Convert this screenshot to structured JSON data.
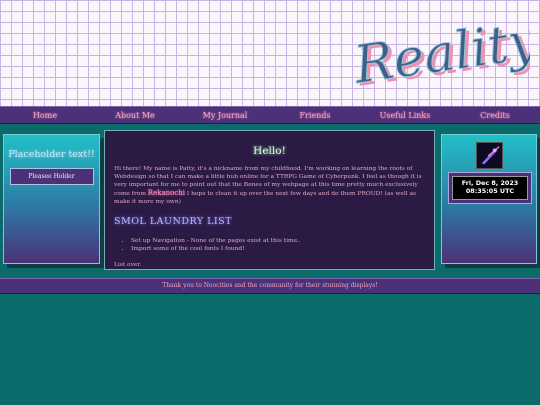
{
  "header": {
    "logo_text": "Reality"
  },
  "nav": {
    "items": [
      "Home",
      "About Me",
      "My Journal",
      "Friends",
      "Useful Links",
      "Credits"
    ]
  },
  "left_panel": {
    "title": "Placeholder text!!",
    "button": "Pleasee Holder"
  },
  "main": {
    "heading": "Hello!",
    "intro_part1": "Hi there! My name is Patty, it's a nickname from my childhood. I'm working on learning the roots of Webdesign so that I can make a little hub online for a TTRPG Game of Cyberpunk. I feel as though it is very important for me to point out that the Bones of my webpage at this time pretty much exclusively come from ",
    "intro_link": "Rekanochi",
    "intro_part2": " I hope to clean it up over the next few days and do them PROUD! (as well as make it more my own)",
    "list_heading": "SMOL LAUNDRY LIST",
    "list_items": [
      "Set up Navigation - None of the pages exist at this time..",
      "Import some of the cool fonts I found!"
    ],
    "closing": "List over."
  },
  "right_panel": {
    "date": "Fri, Dec 8, 2023",
    "time": "08:35:05 UTC"
  },
  "footer": {
    "text": "Thank you to Neocities and the community for their stunning displays!"
  },
  "colors": {
    "background": "#0b6b6a",
    "nav_bg": "#4b3178",
    "link_pink": "#f2a5c2",
    "panel_teal": "#21c0c7",
    "main_bg": "#2a1a44"
  }
}
